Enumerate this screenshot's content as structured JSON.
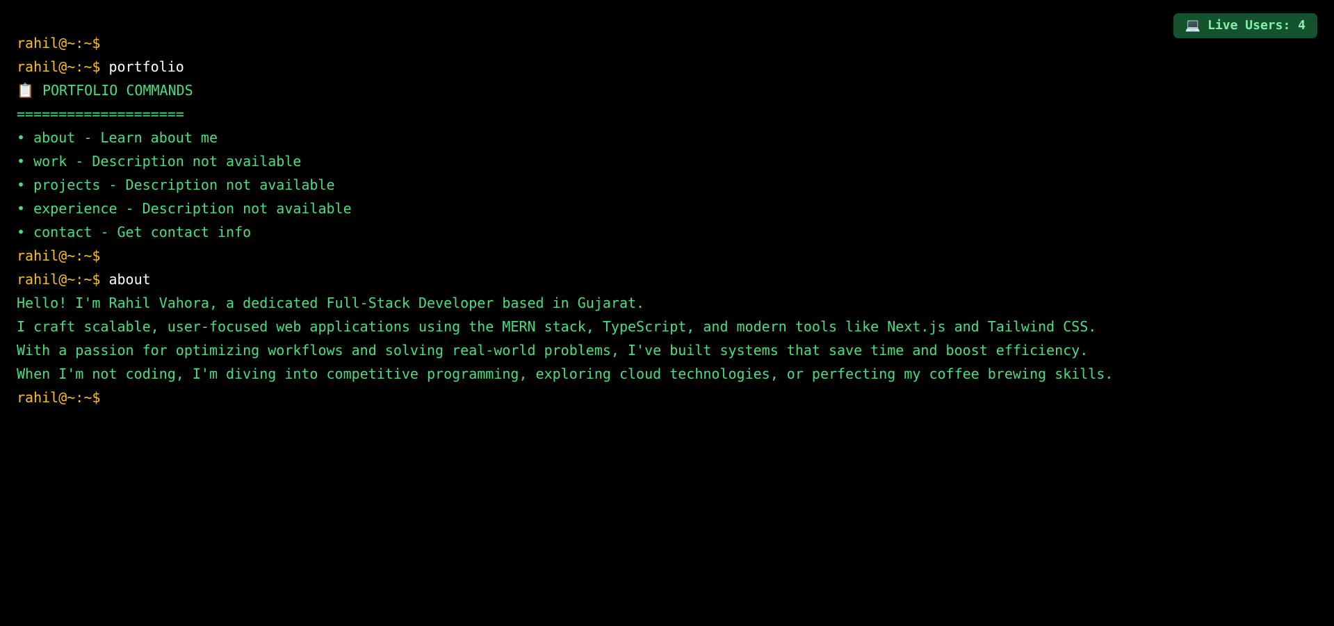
{
  "badge": {
    "icon": "laptop-icon",
    "glyph": "💻",
    "label": "Live Users: 4"
  },
  "terminal": {
    "prompt": "rahil@~:~$",
    "lines": [
      {
        "type": "prompt",
        "command": ""
      },
      {
        "type": "prompt",
        "command": "portfolio"
      },
      {
        "type": "output",
        "text": "PORTFOLIO COMMANDS",
        "icon": "clipboard-icon",
        "glyph": "📋"
      },
      {
        "type": "output",
        "text": "===================="
      },
      {
        "type": "output",
        "text": "• about - Learn about me"
      },
      {
        "type": "output",
        "text": "• work - Description not available"
      },
      {
        "type": "output",
        "text": "• projects - Description not available"
      },
      {
        "type": "output",
        "text": "• experience - Description not available"
      },
      {
        "type": "output",
        "text": "• contact - Get contact info"
      },
      {
        "type": "prompt",
        "command": ""
      },
      {
        "type": "prompt",
        "command": "about"
      },
      {
        "type": "output",
        "text": "Hello! I'm Rahil Vahora, a dedicated Full-Stack Developer based in Gujarat."
      },
      {
        "type": "output",
        "text": "I craft scalable, user-focused web applications using the MERN stack, TypeScript, and modern tools like Next.js and Tailwind CSS."
      },
      {
        "type": "output",
        "text": "With a passion for optimizing workflows and solving real-world problems, I've built systems that save time and boost efficiency."
      },
      {
        "type": "output",
        "text": "When I'm not coding, I'm diving into competitive programming, exploring cloud technologies, or perfecting my coffee brewing skills."
      },
      {
        "type": "prompt",
        "command": ""
      }
    ]
  },
  "colors": {
    "background": "#000000",
    "prompt": "#fbbf24",
    "command": "#ffffff",
    "output": "#4ade80",
    "badge_bg": "#14532d",
    "badge_text": "#86efac"
  }
}
